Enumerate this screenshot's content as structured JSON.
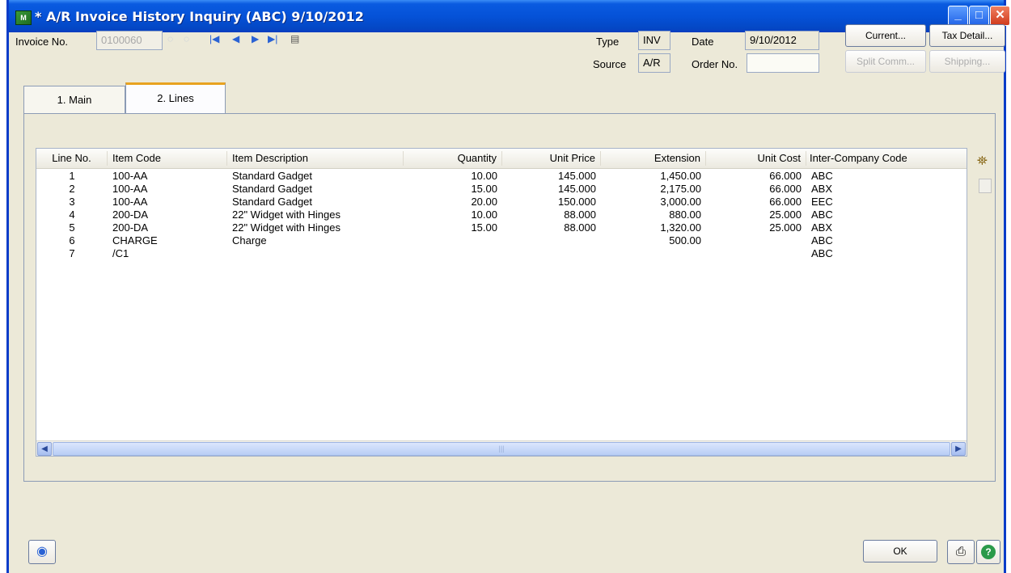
{
  "window": {
    "title": "* A/R Invoice History Inquiry (ABC) 9/10/2012",
    "icon": "app-icon",
    "controls": {
      "minimize": "minimize-icon",
      "maximize": "maximize-icon",
      "close": "close-icon"
    }
  },
  "header": {
    "invoice_label": "Invoice No.",
    "invoice_value": "0100060",
    "type_label": "Type",
    "type_value": "INV",
    "date_label": "Date",
    "date_value": "9/10/2012",
    "source_label": "Source",
    "source_value": "A/R",
    "order_label": "Order No.",
    "order_value": "",
    "buttons": {
      "current": "Current...",
      "tax_detail": "Tax Detail...",
      "split_comm": "Split Comm...",
      "shipping": "Shipping..."
    }
  },
  "tabs": [
    {
      "label": "1. Main",
      "active": false
    },
    {
      "label": "2. Lines",
      "active": true
    }
  ],
  "grid": {
    "columns": [
      "Line No.",
      "Item Code",
      "Item Description",
      "Quantity",
      "Unit Price",
      "Extension",
      "Unit Cost",
      "Inter-Company Code"
    ],
    "rows": [
      [
        "1",
        "100-AA",
        "Standard Gadget",
        "10.00",
        "145.000",
        "1,450.00",
        "66.000",
        "ABC"
      ],
      [
        "2",
        "100-AA",
        "Standard Gadget",
        "15.00",
        "145.000",
        "2,175.00",
        "66.000",
        "ABX"
      ],
      [
        "3",
        "100-AA",
        "Standard Gadget",
        "20.00",
        "150.000",
        "3,000.00",
        "66.000",
        "EEC"
      ],
      [
        "4",
        "200-DA",
        "22\" Widget with Hinges",
        "10.00",
        "88.000",
        "880.00",
        "25.000",
        "ABC"
      ],
      [
        "5",
        "200-DA",
        "22\" Widget with Hinges",
        "15.00",
        "88.000",
        "1,320.00",
        "25.000",
        "ABX"
      ],
      [
        "6",
        "CHARGE",
        "Charge",
        "",
        "",
        "500.00",
        "",
        "ABC"
      ],
      [
        "7",
        "/C1",
        "",
        "",
        "",
        "",
        "",
        "ABC"
      ]
    ]
  },
  "footer": {
    "ok": "OK"
  },
  "colors": {
    "titlebar": "#0552d8",
    "window_face": "#ece9d8",
    "tab_accent": "#e8a21f"
  }
}
